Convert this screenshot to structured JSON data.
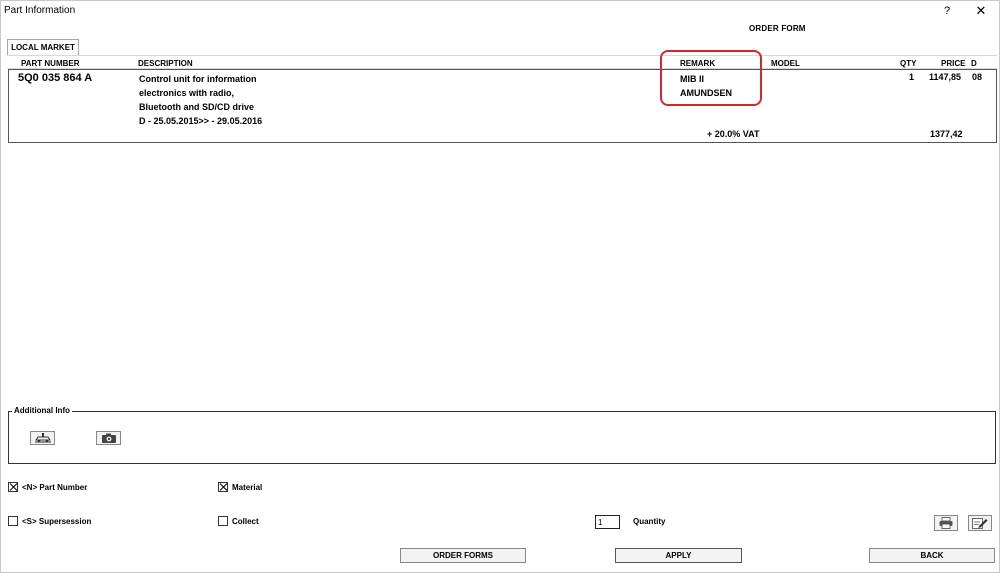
{
  "window": {
    "title": "Part Information",
    "help": "?",
    "close": "✕"
  },
  "form_title": "ORDER FORM",
  "tab": {
    "label": "LOCAL MARKET"
  },
  "columns": {
    "part_number": "PART NUMBER",
    "description": "DESCRIPTION",
    "remark": "REMARK",
    "model": "MODEL",
    "qty": "QTY",
    "price": "PRICE",
    "d": "D"
  },
  "row": {
    "part_number": "5Q0 035 864 A",
    "description": [
      "Control unit for information",
      "electronics with radio,",
      "Bluetooth and SD/CD drive",
      "D - 25.05.2015>> - 29.05.2016"
    ],
    "remark": [
      "MIB II",
      "AMUNDSEN"
    ],
    "qty": "1",
    "price": "1147,85",
    "d": "08"
  },
  "vat": {
    "label": "+ 20.0% VAT",
    "value": "1377,42"
  },
  "additional_info": {
    "legend": "Additional Info",
    "icons": [
      "vehicle-lift-icon",
      "camera-icon"
    ]
  },
  "options": {
    "part_number": {
      "label": "<N> Part Number",
      "checked": true
    },
    "material": {
      "label": "Material",
      "checked": true
    },
    "supersession": {
      "label": "<S> Supersession",
      "checked": false
    },
    "collect": {
      "label": "Collect",
      "checked": false
    }
  },
  "quantity": {
    "value": "1",
    "label": "Quantity"
  },
  "buttons": {
    "order_forms": "ORDER FORMS",
    "apply": "APPLY",
    "back": "BACK"
  },
  "colors": {
    "highlight": "#d7262f",
    "body_border": "#555555"
  }
}
